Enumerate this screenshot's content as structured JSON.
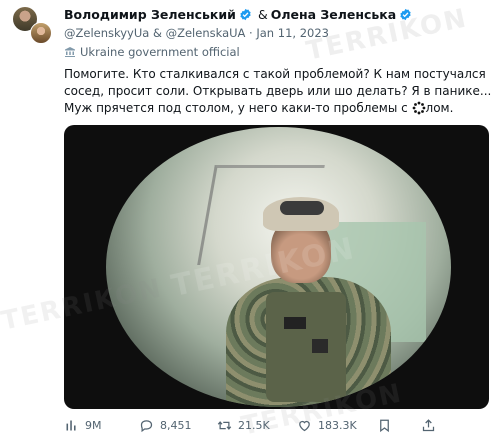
{
  "tweet": {
    "author1_name": "Володимир Зеленський",
    "ampersand": "&",
    "author2_name": "Олена Зеленська",
    "handles": "@ZelenskyyUa & @ZelenskaUA · Jan 11, 2023",
    "label": "Ukraine government official",
    "text_before": "Помогите. Кто сталкивался с такой проблемой? К нам постучался сосед, просит соли. Открывать дверь или шо делать? Я в панике... Муж прячется под столом, у него каки-то проблемы с ",
    "text_after": "лом."
  },
  "watermark": "TERRIKON",
  "actions": {
    "views": "9M",
    "replies": "8,451",
    "reposts": "21.5K",
    "likes": "183.3K"
  },
  "colors": {
    "verified": "#1d9bf0",
    "secondary_text": "#536471",
    "primary_text": "#0f1419"
  },
  "icons": {
    "verified": "verified-badge-icon",
    "government": "government-building-icon",
    "cursor": "loading-cursor-icon",
    "views": "bar-chart-icon",
    "replies": "speech-bubble-icon",
    "reposts": "repost-arrows-icon",
    "likes": "heart-icon",
    "bookmark": "bookmark-icon",
    "share": "share-icon"
  }
}
